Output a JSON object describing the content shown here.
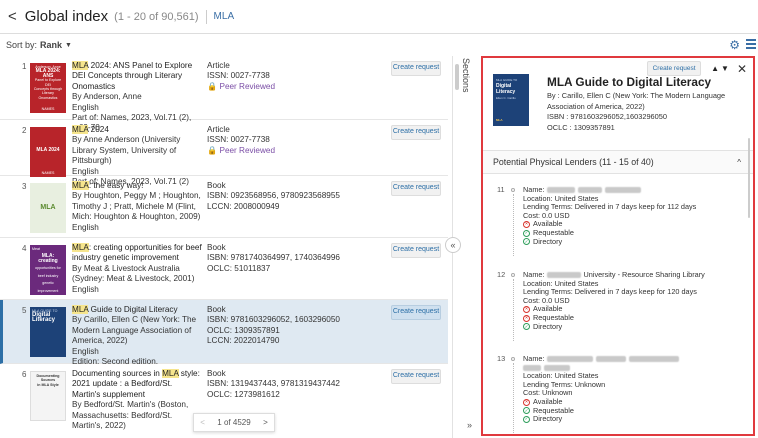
{
  "header": {
    "back_label": "<",
    "title": "Global index",
    "count": "(1 - 20 of 90,561)",
    "query": "MLA"
  },
  "sort": {
    "label": "Sort by:",
    "value": "Rank"
  },
  "results": [
    {
      "num": "1",
      "thumb": {
        "lines": [
          "Anderson, Anne",
          "MLA 2024: ANS",
          "Panel to Explore DEI",
          "Concepts through Literary",
          "Onomastics"
        ],
        "footer": "NAMES"
      },
      "title_hl": "MLA",
      "title_rest": " 2024: ANS Panel to Explore DEI Concepts through Literary Onomastics",
      "author": "By Anderson, Anne",
      "lang": "English",
      "part": "Part of: Names, 2023, Vol.71 (2), p.69-70",
      "type": "Article",
      "id1": "ISSN: 0027-7738",
      "id2": "Peer Reviewed",
      "button": "Create request"
    },
    {
      "num": "2",
      "thumb": {
        "lines": [
          "",
          "",
          "MLA 2024"
        ],
        "footer": "NAMES"
      },
      "title_hl": "MLA",
      "title_rest": " 2024",
      "author": "By Anne Anderson (University Library System, University of Pittsburgh)",
      "lang": "English",
      "part": "Part of: Names, 2023, Vol.71 (2)",
      "type": "Article",
      "id1": "ISSN: 0027-7738",
      "id2": "Peer Reviewed",
      "button": "Create request"
    },
    {
      "num": "3",
      "thumb": {
        "lines": [
          "MLA"
        ],
        "footer": ""
      },
      "title_hl": "MLA",
      "title_rest": ": the easy way!",
      "author": "By Houghton, Peggy M ; Houghton, Timothy J ; Pratt, Michele M (Flint, Mich: Houghton & Houghton, 2009)",
      "lang": "English",
      "type": "Book",
      "id1": "ISBN: 0923568956, 9780923568955",
      "id2": "LCCN: 2008000949",
      "button": "Create request"
    },
    {
      "num": "4",
      "thumb": {
        "lines": [
          "Meat",
          "MLA: creating",
          "opportunities for",
          "beef industry",
          "genetic",
          "improvement"
        ],
        "footer": ""
      },
      "title_hl": "MLA",
      "title_rest": ": creating opportunities for beef industry genetic improvement",
      "author": "By Meat & Livestock Australia (Sydney: Meat & Livestock, 2001)",
      "lang": "English",
      "type": "Book",
      "id1": "ISBN: 9781740364997, 1740364996",
      "id2": "OCLC: 51011837",
      "button": "Create request"
    },
    {
      "num": "5",
      "thumb": {
        "lines": [
          "MLA GUIDE TO",
          "Digital",
          "Literacy"
        ],
        "footer": ""
      },
      "title_hl": "MLA",
      "title_rest": " Guide to Digital Literacy",
      "author": "By Carillo, Ellen C (New York: The Modern Language Association of America, 2022)",
      "lang": "English",
      "edition": "Edition: Second edition.",
      "type": "Book",
      "id1": "ISBN: 9781603296052, 1603296050",
      "id2": "OCLC: 1309357891",
      "id3": "LCCN: 2022014790",
      "button": "Create request"
    },
    {
      "num": "6",
      "thumb": {
        "lines": [
          "Documenting Sources",
          "in MLA Style"
        ],
        "footer": ""
      },
      "title_pre": "Documenting sources in ",
      "title_hl": "MLA",
      "title_rest": " style: 2021 update : a Bedford/St. Martin's supplement",
      "author": "By Bedford/St. Martin's (Boston, Massachusetts: Bedford/St. Martin's, 2022)",
      "type": "Book",
      "id1": "ISBN: 1319437443, 9781319437442",
      "id2": "OCLC: 1273981612",
      "button": "Create request"
    }
  ],
  "pager": {
    "prev": "<",
    "text": "1 of 4529",
    "next": ">"
  },
  "sections_label": "Sections",
  "collapse_label": "«",
  "expand_label": "»",
  "detail": {
    "create_request": "Create request",
    "up": "▲",
    "down": "▼",
    "close": "✕",
    "thumb": {
      "top": "MLA GUIDE TO",
      "l1": "Digital",
      "l2": "Literacy",
      "author": "Ellen C. Carillo",
      "footer": "MLA"
    },
    "title": "MLA Guide to Digital Literacy",
    "by": "By : Carillo, Ellen C (New York: The Modern Language Association of America, 2022)",
    "isbn": "ISBN : 9781603296052,1603296050",
    "oclc": "OCLC : 1309357891",
    "section_title": "Potential Physical Lenders (11 - 15 of 40)",
    "section_chevron": "^",
    "lenders": [
      {
        "num": "11",
        "name_label": "Name:",
        "name_visible": "",
        "location": "Location: United States",
        "terms": "Lending Terms: Delivered in 7 days keep for 112 days",
        "cost": "Cost: 0.0 USD",
        "statuses": [
          {
            "label": "Available",
            "ok": false
          },
          {
            "label": "Requestable",
            "ok": true
          },
          {
            "label": "Directory",
            "ok": true
          }
        ]
      },
      {
        "num": "12",
        "name_label": "Name:",
        "name_visible": "University - Resource Sharing Library",
        "location": "Location: United States",
        "terms": "Lending Terms: Delivered in 7 days keep for 120 days",
        "cost": "Cost: 0.0 USD",
        "statuses": [
          {
            "label": "Available",
            "ok": false
          },
          {
            "label": "Requestable",
            "ok": false
          },
          {
            "label": "Directory",
            "ok": true
          }
        ]
      },
      {
        "num": "13",
        "name_label": "Name:",
        "name_visible": "",
        "location": "Location: United States",
        "terms": "Lending Terms: Unknown",
        "cost": "Cost: Unknown",
        "statuses": [
          {
            "label": "Available",
            "ok": false
          },
          {
            "label": "Requestable",
            "ok": true
          },
          {
            "label": "Directory",
            "ok": true
          }
        ]
      }
    ]
  },
  "colors": {
    "accent": "#2d6fa6",
    "highlight": "#f6e58d",
    "selected_row": "#dfe9f2",
    "detail_border": "#e0393e",
    "ok": "#2e9e5b",
    "error": "#d8342d"
  },
  "icons": {
    "back": "chevron-left-icon",
    "settings": "gear-icon",
    "menu": "hamburger-menu-icon",
    "peer": "lock-icon",
    "close": "close-icon"
  }
}
